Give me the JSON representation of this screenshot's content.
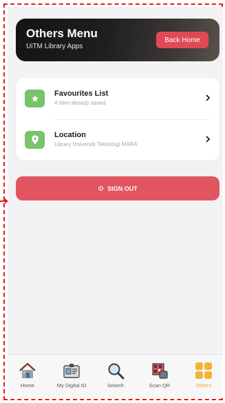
{
  "header": {
    "title": "Others Menu",
    "subtitle": "UiTM Library Apps",
    "back_label": "Back Home"
  },
  "menu": [
    {
      "title": "Favourites List",
      "subtitle": "4 Item already saved",
      "icon": "star-icon"
    },
    {
      "title": "Location",
      "subtitle": "Library Universiti Teknologi MARA",
      "icon": "location-pin-icon"
    }
  ],
  "signout": {
    "label": "SIGN OUT",
    "icon": "power-icon"
  },
  "tabs": [
    {
      "label": "Home",
      "icon": "home-icon"
    },
    {
      "label": "My Digital ID",
      "icon": "id-card-icon"
    },
    {
      "label": "Search",
      "icon": "magnifier-icon"
    },
    {
      "label": "Scan QR",
      "icon": "qr-scan-icon"
    },
    {
      "label": "Others",
      "icon": "grid-icon",
      "active": true
    }
  ],
  "colors": {
    "accent_red": "#e05560",
    "icon_green": "#79c36a",
    "active_tab": "#f2a32c"
  }
}
